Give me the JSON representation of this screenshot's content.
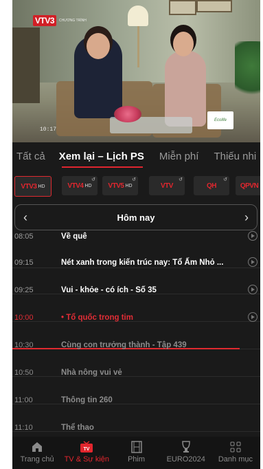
{
  "video": {
    "logo": "VTV3",
    "logo_sub": "CHƯƠNG TRÌNH",
    "timestamp": "10:17",
    "corner_badge": "Ecolife"
  },
  "tabs": [
    "Tất cả",
    "Xem lại – Lịch PS",
    "Miễn phí",
    "Thiếu nhi"
  ],
  "channels": [
    {
      "name": "VTV3",
      "hd": "HD",
      "selected": true
    },
    {
      "name": "VTV4",
      "hd": "HD",
      "selected": false
    },
    {
      "name": "VTV5",
      "hd": "HD",
      "selected": false
    },
    {
      "name": "VTV",
      "hd": "",
      "selected": false
    },
    {
      "name": "QH",
      "hd": "",
      "selected": false
    },
    {
      "name": "QPVN",
      "hd": "",
      "selected": false
    }
  ],
  "day_selector": {
    "label": "Hôm nay"
  },
  "schedule": [
    {
      "time": "08:05",
      "title": "Về quê",
      "state": "past"
    },
    {
      "time": "09:15",
      "title": "Nét xanh trong kiến trúc nay: Tổ Ấm Nhỏ ...",
      "state": "past"
    },
    {
      "time": "09:25",
      "title": "Vui - khỏe - có ích - Số 35",
      "state": "past"
    },
    {
      "time": "10:00",
      "title": "•  Tổ quốc trong tim",
      "state": "current"
    },
    {
      "time": "10:30",
      "title": "Cùng con trưởng thành - Tập 439",
      "state": "future"
    },
    {
      "time": "10:50",
      "title": "Nhà nông vui vẻ",
      "state": "future"
    },
    {
      "time": "11:00",
      "title": "Thông tin 260",
      "state": "future"
    },
    {
      "time": "11:10",
      "title": "Thể thao",
      "state": "future"
    }
  ],
  "bottom_nav": [
    {
      "label": "Trang chủ",
      "icon": "home-icon",
      "active": false
    },
    {
      "label": "TV & Sự kiện",
      "icon": "tv-icon",
      "active": true
    },
    {
      "label": "Phim",
      "icon": "film-icon",
      "active": false
    },
    {
      "label": "EURO2024",
      "icon": "trophy-icon",
      "active": false
    },
    {
      "label": "Danh mục",
      "icon": "grid-icon",
      "active": false
    }
  ],
  "colors": {
    "accent": "#e02a30",
    "background": "#1a1a1a"
  }
}
